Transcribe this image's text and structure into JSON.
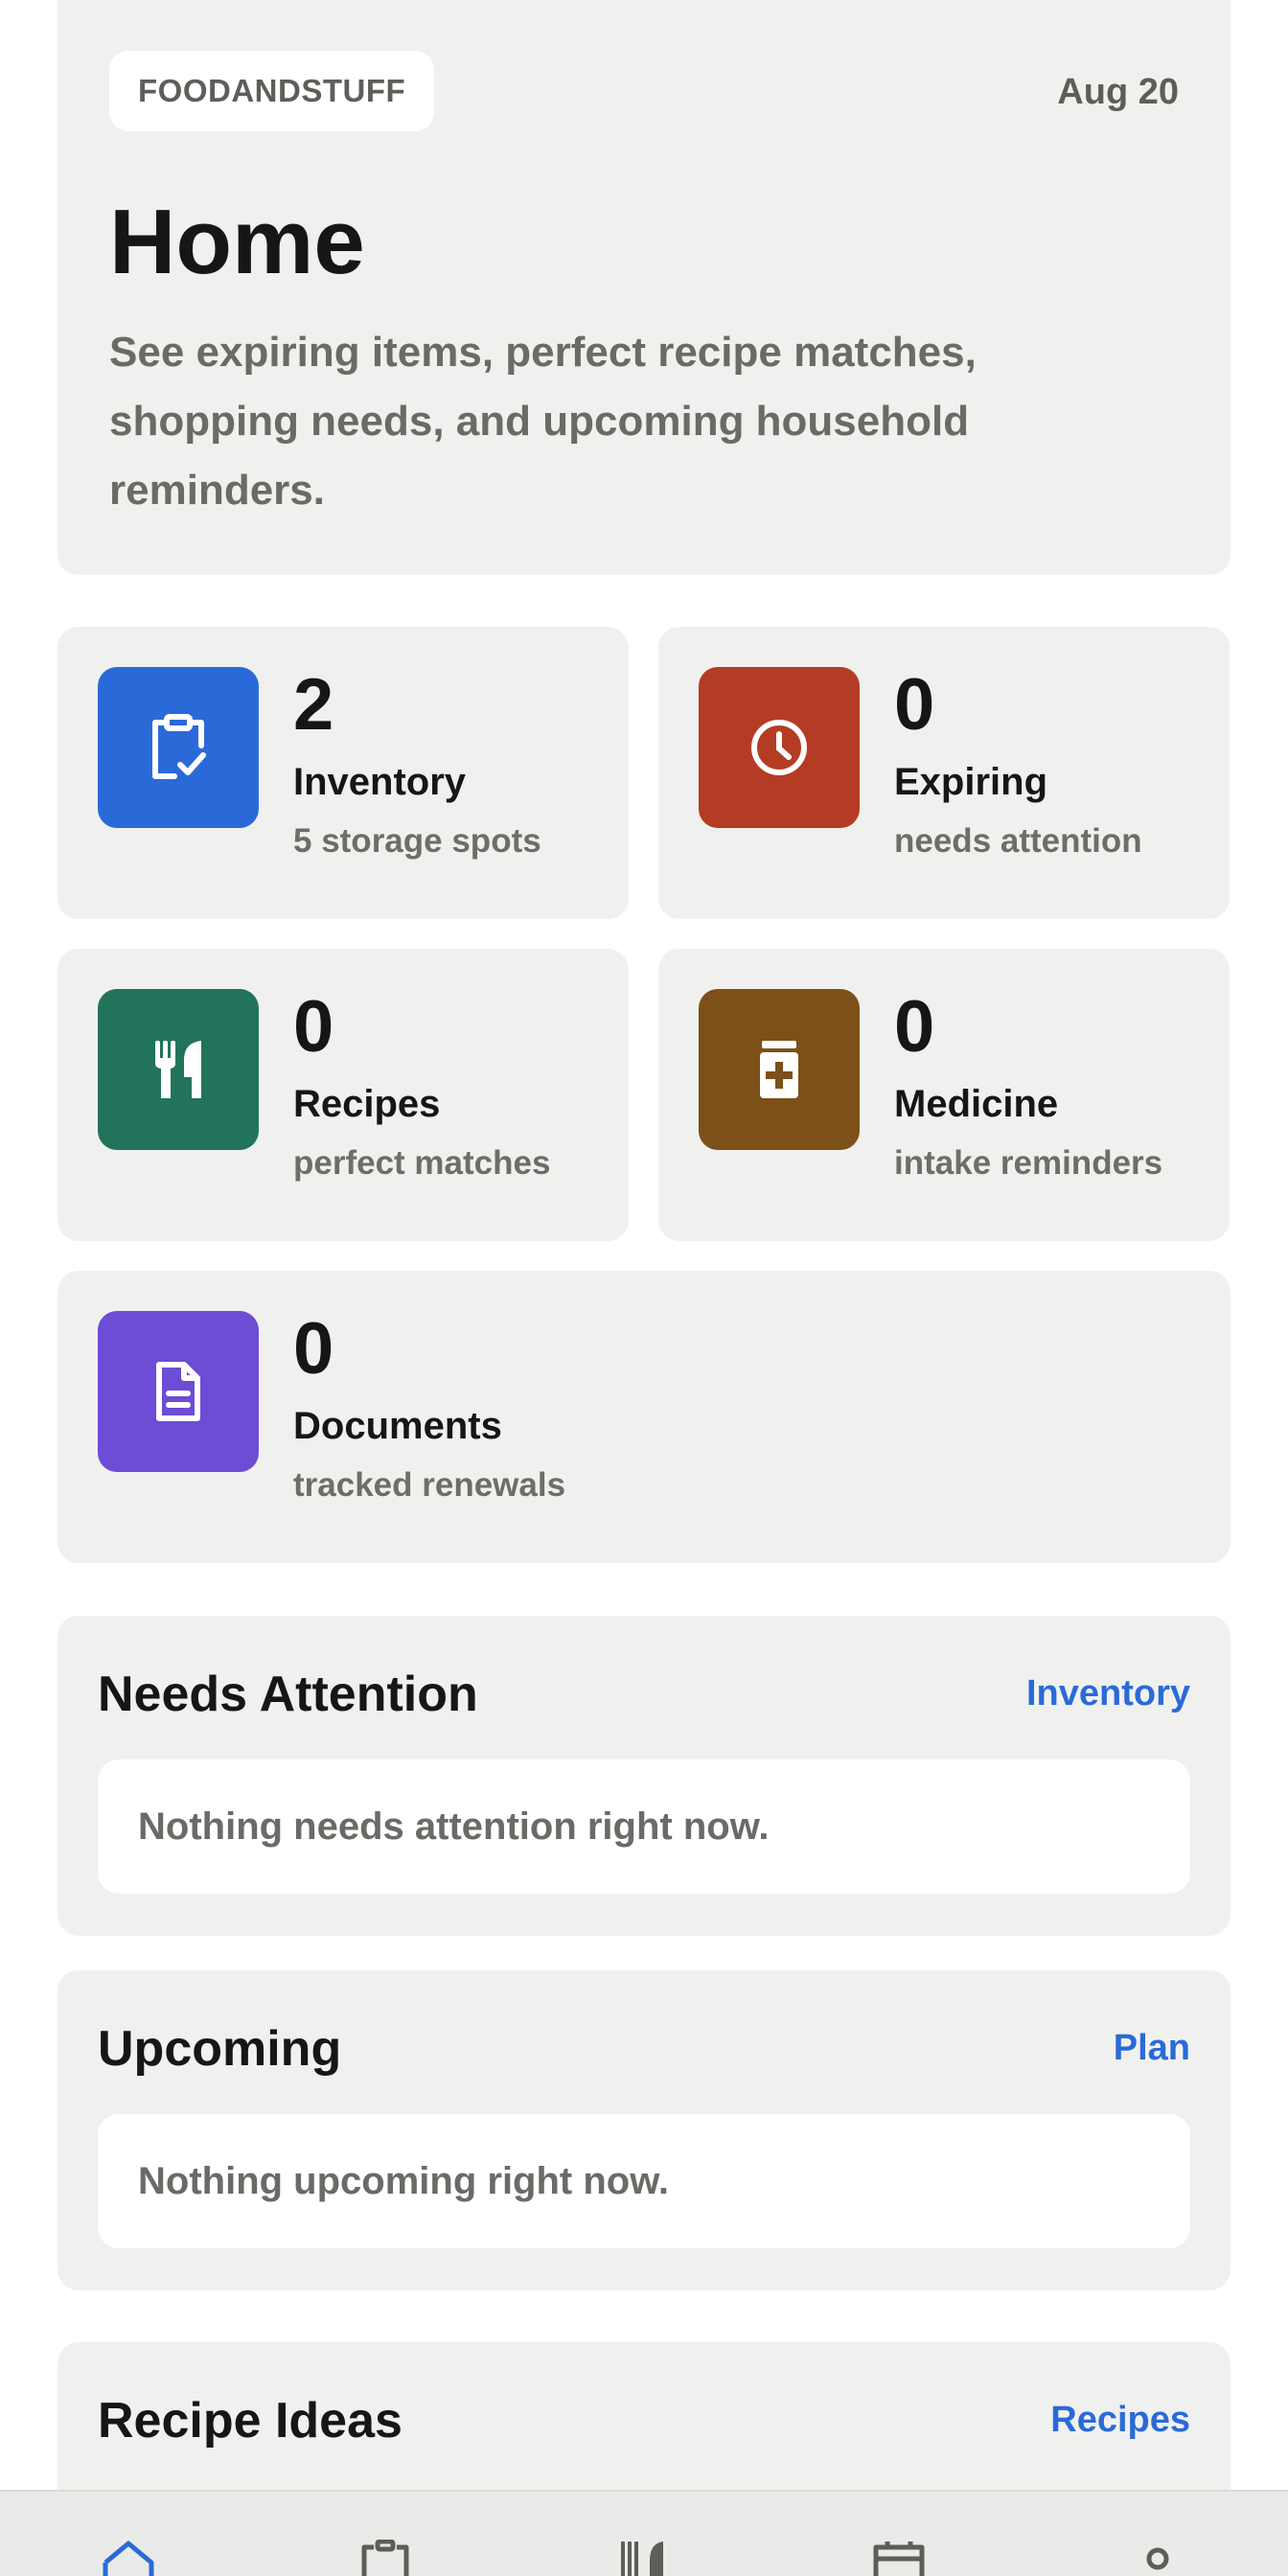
{
  "header": {
    "brand": "FOODANDSTUFF",
    "date": "Aug 20",
    "title": "Home",
    "description": "See expiring items, perfect recipe matches, shopping needs, and upcoming household reminders."
  },
  "stats": [
    {
      "icon": "clipboard-check-icon",
      "color": "#2a6ad8",
      "count": "2",
      "label": "Inventory",
      "sub": "5 storage spots"
    },
    {
      "icon": "clock-icon",
      "color": "#b43c24",
      "count": "0",
      "label": "Expiring",
      "sub": "needs attention"
    },
    {
      "icon": "fork-knife-icon",
      "color": "#22735c",
      "count": "0",
      "label": "Recipes",
      "sub": "perfect matches"
    },
    {
      "icon": "medicine-jar-icon",
      "color": "#7c5018",
      "count": "0",
      "label": "Medicine",
      "sub": "intake reminders"
    },
    {
      "icon": "document-icon",
      "color": "#6d4cd6",
      "count": "0",
      "label": "Documents",
      "sub": "tracked renewals"
    }
  ],
  "needs_attention": {
    "title": "Needs Attention",
    "link": "Inventory",
    "empty": "Nothing needs attention right now."
  },
  "upcoming": {
    "title": "Upcoming",
    "link": "Plan",
    "empty": "Nothing upcoming right now."
  },
  "recipe_ideas": {
    "title": "Recipe Ideas",
    "link": "Recipes"
  },
  "bottom_nav": {
    "items": [
      "home-icon",
      "clipboard-icon",
      "fork-knife-icon",
      "calendar-icon",
      "profile-icon"
    ],
    "active_color": "#2a6ad8",
    "inactive_color": "#5c5f59"
  }
}
